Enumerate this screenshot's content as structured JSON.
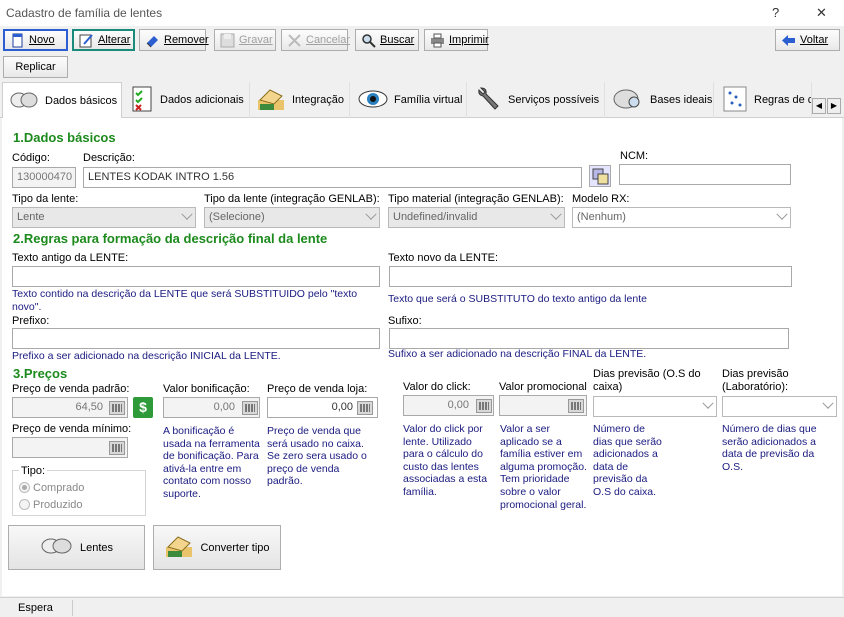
{
  "window": {
    "title": "Cadastro de família de lentes",
    "help": "?",
    "close": "✕"
  },
  "toolbar": {
    "novo": "Novo",
    "alterar": "Alterar",
    "remover": "Remover",
    "gravar": "Gravar",
    "cancelar": "Cancelar",
    "buscar": "Buscar",
    "imprimir": "Imprimir",
    "voltar": "Voltar",
    "replicar": "Replicar"
  },
  "tabs": [
    {
      "label": "Dados básicos"
    },
    {
      "label": "Dados adicionais"
    },
    {
      "label": "Integração"
    },
    {
      "label": "Família virtual"
    },
    {
      "label": "Serviços possíveis"
    },
    {
      "label": "Bases ideais"
    },
    {
      "label": "Regras de c"
    }
  ],
  "sec1": {
    "title": "1.Dados básicos",
    "codigo_label": "Código:",
    "codigo": "130000470",
    "descricao_label": "Descrição:",
    "descricao": "LENTES KODAK INTRO 1.56",
    "ncm_label": "NCM:",
    "ncm": "",
    "tipo_lente_label": "Tipo da lente:",
    "tipo_lente": "Lente",
    "tipo_genlab_label": "Tipo da lente (integração GENLAB):",
    "tipo_genlab": "(Selecione)",
    "material_label": "Tipo material (integração GENLAB):",
    "material": "Undefined/invalid",
    "modelo_label": "Modelo RX:",
    "modelo": "(Nenhum)"
  },
  "sec2": {
    "title": "2.Regras para formação da descrição final da lente",
    "antigo_label": "Texto antigo da LENTE:",
    "antigo_help": "Texto contido na descrição da LENTE que será SUBSTITUIDO pelo \"texto novo\".",
    "novo_label": "Texto novo da LENTE:",
    "novo_help": "Texto que será o SUBSTITUTO do texto antigo da lente",
    "prefixo_label": "Prefixo:",
    "prefixo_help": "Prefixo a ser adicionado na descrição INICIAL da LENTE.",
    "sufixo_label": "Sufixo:",
    "sufixo_help": "Sufixo a ser adicionado na descrição FINAL da LENTE."
  },
  "sec3": {
    "title": "3.Preços",
    "venda_label": "Preço de venda padrão:",
    "venda": "64,50",
    "minimo_label": "Preço de venda mínimo:",
    "bonif_label": "Valor bonificação:",
    "bonif": "0,00",
    "bonif_help": "A bonificação é usada na ferramenta de bonificação. Para ativá-la entre em contato com nosso suporte.",
    "loja_label": "Preço de venda loja:",
    "loja": "0,00",
    "loja_help": "Preço de venda que será usado no caixa. Se zero sera usado o preço de venda padrão.",
    "click_label": "Valor do click:",
    "click": "0,00",
    "click_help": "Valor do click por lente. Utilizado para o cálculo do custo das lentes associadas a esta família.",
    "promo_label": "Valor promocional",
    "promo_help": "Valor a ser aplicado se a família estiver em alguma promoção. Tem prioridade sobre o valor promocional geral.",
    "caixa_label": "Dias previsão (O.S do caixa)",
    "caixa_help": "Número de dias que serão adicionados a data de previsão da O.S do caixa.",
    "lab_label": "Dias previsão (Laboratório):",
    "lab_help": "Número de dias que serão adicionados a data de previsão da O.S.",
    "tipo_label": "Tipo:",
    "comprado": "Comprado",
    "produzido": "Produzido",
    "lentes_btn": "Lentes",
    "converter_btn": "Converter tipo"
  },
  "status": "Espera",
  "colors": {
    "section": "#1c8a1c",
    "help": "#1a1a80"
  }
}
